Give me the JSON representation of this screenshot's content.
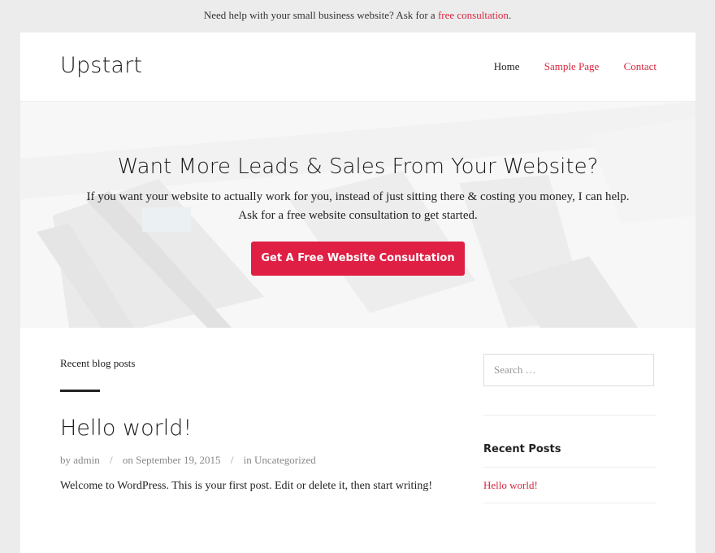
{
  "topbar": {
    "text": "Need help with your small business website? Ask for a",
    "link": "free consultation",
    "suffix": "."
  },
  "header": {
    "site_title": "Upstart",
    "nav": [
      {
        "label": "Home",
        "current": true
      },
      {
        "label": "Sample Page",
        "current": false
      },
      {
        "label": "Contact",
        "current": false
      }
    ]
  },
  "hero": {
    "title": "Want More Leads & Sales From Your Website?",
    "text_line1": "If you want your website to actually work for you, instead of just sitting there & costing you money, I can help.",
    "text_line2": "Ask for a free website consultation to get started.",
    "button_label": "Get A Free Website Consultation"
  },
  "main": {
    "section_label": "Recent blog posts",
    "post": {
      "title": "Hello world!",
      "meta_by": "by",
      "author": "admin",
      "meta_on": "on",
      "date": "September 19, 2015",
      "meta_in": "in",
      "category": "Uncategorized",
      "excerpt": "Welcome to WordPress. This is your first post. Edit or delete it, then start writing!"
    }
  },
  "sidebar": {
    "search_placeholder": "Search …",
    "recent_posts_title": "Recent Posts",
    "recent_posts": [
      "Hello world!"
    ]
  },
  "colors": {
    "accent": "#df1f44",
    "link": "#d9263f",
    "page_bg": "#ececec"
  }
}
